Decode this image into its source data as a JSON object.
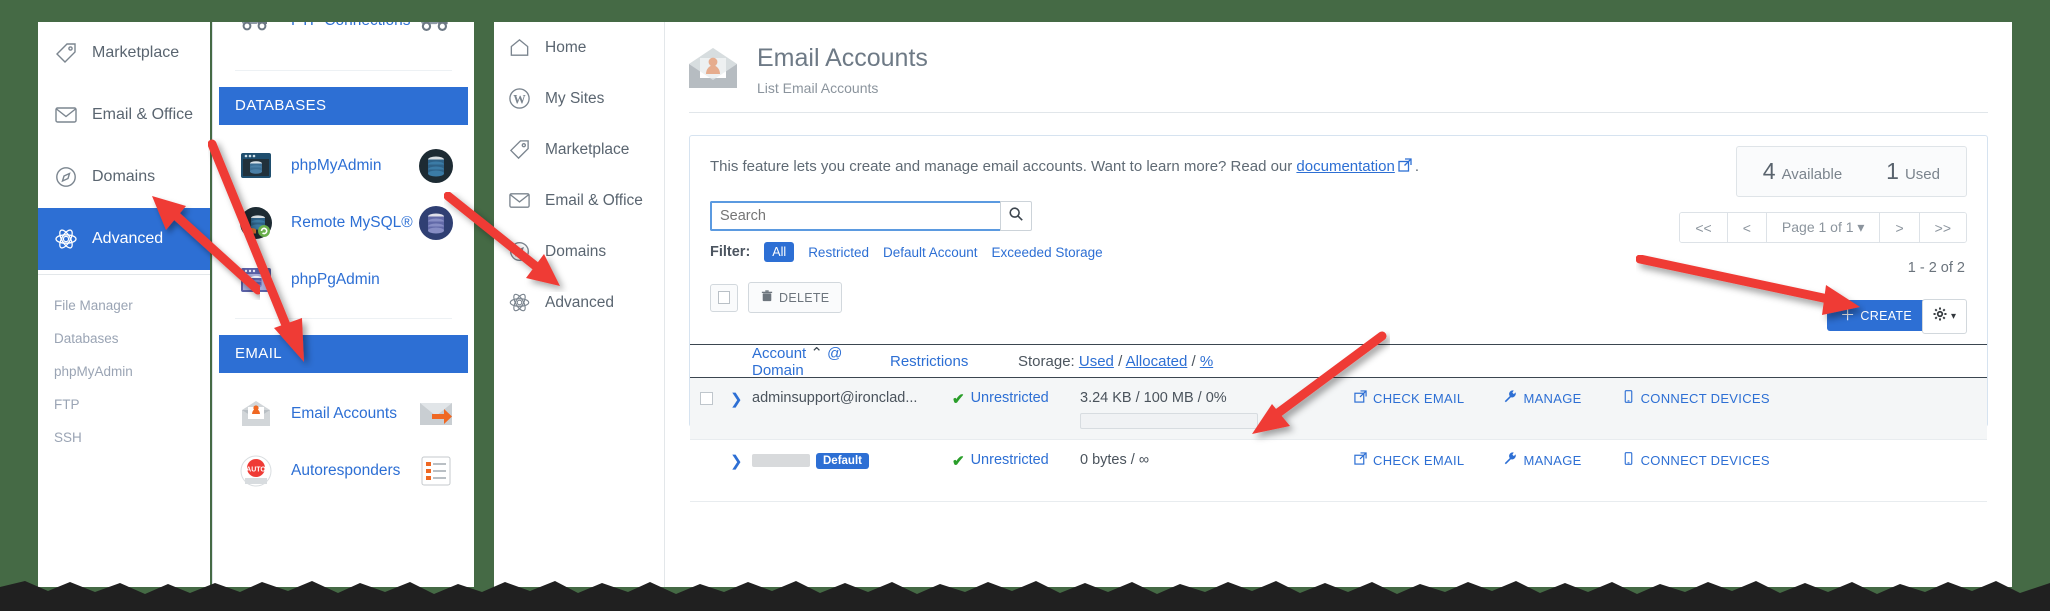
{
  "sidebar_left": {
    "items": [
      {
        "label": "Marketplace",
        "icon": "tag-icon",
        "active": false
      },
      {
        "label": "Email & Office",
        "icon": "envelope-icon",
        "active": false
      },
      {
        "label": "Domains",
        "icon": "compass-icon",
        "active": false
      },
      {
        "label": "Advanced",
        "icon": "atom-icon",
        "active": true
      }
    ],
    "sub_items": [
      "File Manager",
      "Databases",
      "phpMyAdmin",
      "FTP",
      "SSH"
    ]
  },
  "tiles_panel": {
    "top_partial_tile": "FTP Connections",
    "sections": [
      {
        "title": "DATABASES",
        "tiles": [
          {
            "label": "phpMyAdmin",
            "icon": "phpmyadmin-icon"
          },
          {
            "label": "Remote MySQL®",
            "icon": "remote-mysql-icon"
          },
          {
            "label": "phpPgAdmin",
            "icon": "phppgadmin-icon"
          }
        ]
      },
      {
        "title": "EMAIL",
        "tiles": [
          {
            "label": "Email Accounts",
            "icon": "email-accounts-icon"
          },
          {
            "label": "Autoresponders",
            "icon": "autoresponders-icon"
          }
        ]
      }
    ]
  },
  "sidebar_right": {
    "items": [
      {
        "label": "Home",
        "icon": "home-icon"
      },
      {
        "label": "My Sites",
        "icon": "wordpress-icon"
      },
      {
        "label": "Marketplace",
        "icon": "tag-icon"
      },
      {
        "label": "Email & Office",
        "icon": "envelope-icon"
      },
      {
        "label": "Domains",
        "icon": "compass-icon"
      },
      {
        "label": "Advanced",
        "icon": "atom-icon"
      }
    ]
  },
  "main": {
    "title": "Email Accounts",
    "subtitle": "List Email Accounts",
    "notice": {
      "text_before": "This feature lets you create and manage email accounts. Want to learn more? Read our ",
      "link": "documentation",
      "text_after": "."
    },
    "counters": {
      "available_value": "4",
      "available_label": "Available",
      "used_value": "1",
      "used_label": "Used"
    },
    "search": {
      "placeholder": "Search",
      "value": "",
      "icon": "search-icon"
    },
    "filter": {
      "label": "Filter:",
      "options": [
        "All",
        "Restricted",
        "Default Account",
        "Exceeded Storage"
      ],
      "selected": "All"
    },
    "pager": {
      "first": "<<",
      "prev": "<",
      "page_label": "Page 1 of 1",
      "next": ">",
      "last": ">>",
      "range": "1 - 2 of 2"
    },
    "toolbar": {
      "delete_label": "DELETE",
      "delete_icon": "trash-icon",
      "create_label": "CREATE",
      "create_icon": "plus-icon",
      "gear_icon": "gear-icon"
    },
    "table": {
      "columns": {
        "account": "Account",
        "sort_icon": "caret-up-icon",
        "account_suffix": "@ Domain",
        "restrictions": "Restrictions",
        "storage_prefix": "Storage: ",
        "storage_used": "Used",
        "storage_sep1": " / ",
        "storage_allocated": "Allocated",
        "storage_sep2": " / ",
        "storage_pct": "%"
      },
      "rows": [
        {
          "account": "adminsupport@ironclad...",
          "redacted": false,
          "badge": "",
          "restriction": "Unrestricted",
          "restriction_icon": "check-icon",
          "storage": "3.24 KB / 100 MB / 0%",
          "show_bar": true,
          "actions": [
            {
              "label": "CHECK EMAIL",
              "icon": "external-link-icon"
            },
            {
              "label": "MANAGE",
              "icon": "wrench-icon"
            },
            {
              "label": "CONNECT DEVICES",
              "icon": "mobile-icon"
            }
          ]
        },
        {
          "account": "",
          "redacted": true,
          "badge": "Default",
          "restriction": "Unrestricted",
          "restriction_icon": "check-icon",
          "storage": "0 bytes / ∞",
          "show_bar": false,
          "actions": [
            {
              "label": "CHECK EMAIL",
              "icon": "external-link-icon"
            },
            {
              "label": "MANAGE",
              "icon": "wrench-icon"
            },
            {
              "label": "CONNECT DEVICES",
              "icon": "mobile-icon"
            }
          ]
        }
      ]
    }
  },
  "colors": {
    "accent": "#2d6fd4",
    "background": "#456a45",
    "annotation": "#ef3b36",
    "success": "#2a9e2a"
  }
}
